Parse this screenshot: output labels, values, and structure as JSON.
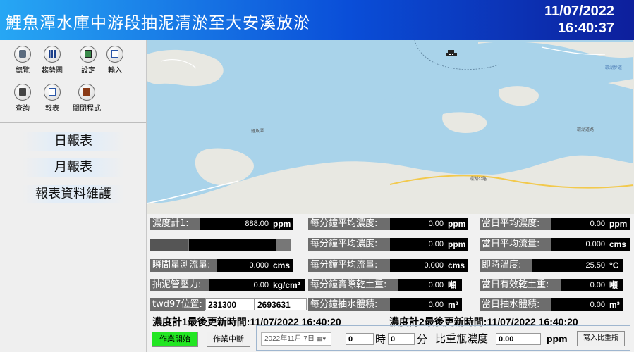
{
  "header": {
    "title": "鯉魚潭水庫中游段抽泥清淤至大安溪放淤",
    "date": "11/07/2022",
    "time": "16:40:37"
  },
  "toolbar": {
    "items": [
      {
        "label": "總覽",
        "icon": "overview-icon"
      },
      {
        "label": "趨勢圖",
        "icon": "trend-chart-icon"
      },
      {
        "label": "設定",
        "icon": "settings-icon"
      },
      {
        "label": "輸入",
        "icon": "input-icon"
      },
      {
        "label": "查詢",
        "icon": "query-icon"
      },
      {
        "label": "報表",
        "icon": "report-icon"
      },
      {
        "label": "關閉程式",
        "icon": "exit-icon"
      }
    ]
  },
  "reports": {
    "daily": "日報表",
    "monthly": "月報表",
    "maintenance": "報表資料維護"
  },
  "map": {
    "labels": [
      "鯉魚潭",
      "環湖道路",
      "環湖公路",
      "環湖步道"
    ]
  },
  "panel": {
    "meter1_label": "濃度計1:",
    "meter1_value": "888.00",
    "meter1_unit": "ppm",
    "progress_level": 0.27,
    "instant_flow_label": "瞬間量測流量:",
    "instant_flow_value": "0.000",
    "instant_flow_unit": "cms",
    "pressure_label": "抽泥管壓力:",
    "pressure_value": "0.00",
    "pressure_unit": "kg/cm²",
    "twd97_label": "twd97位置:",
    "twd97_x": "231300",
    "twd97_y": "2693631",
    "per_min_conc1_label": "每分鐘平均濃度:",
    "per_min_conc1_value": "0.00",
    "per_min_conc1_unit": "ppm",
    "per_min_conc2_label": "每分鐘平均濃度:",
    "per_min_conc2_value": "0.00",
    "per_min_conc2_unit": "ppm",
    "per_min_flow_label": "每分鐘平均流量:",
    "per_min_flow_value": "0.000",
    "per_min_flow_unit": "cms",
    "per_min_dry_label": "每分鐘實際乾土重:",
    "per_min_dry_value": "0.00",
    "per_min_dry_unit": "噸",
    "per_min_vol_label": "每分鐘抽水體積:",
    "per_min_vol_value": "0.00",
    "per_min_vol_unit": "m³",
    "day_conc_label": "當日平均濃度:",
    "day_conc_value": "0.00",
    "day_conc_unit": "ppm",
    "day_flow_label": "當日平均流量:",
    "day_flow_value": "0.000",
    "day_flow_unit": "cms",
    "temp_label": "即時溫度:",
    "temp_value": "25.50",
    "temp_unit": "°C",
    "day_dry_label": "當日有效乾土重:",
    "day_dry_value": "0.00",
    "day_dry_unit": "噸",
    "day_vol_label": "當日抽水體積:",
    "day_vol_value": "0.00",
    "day_vol_unit": "m³",
    "update1": "濃度計1最後更新時間:11/07/2022 16:40:20",
    "update2": "濃度計2最後更新時間:11/07/2022 16:40:20"
  },
  "controls": {
    "start_label": "作業開始",
    "stop_label": "作業中斷",
    "date_value": "2022年11月 7日",
    "hour_value": "0",
    "hour_label": "時",
    "minute_value": "0",
    "minute_label": "分",
    "density_label": "比重瓶濃度",
    "density_value": "0.00",
    "density_unit": "ppm",
    "write_label": "寫入比重瓶"
  },
  "colors": {
    "start_button": "#22e622",
    "label_bg": "#6d6d6d",
    "value_bg": "#000000",
    "water": "#a9d3ea",
    "land": "#e8e8e2"
  }
}
